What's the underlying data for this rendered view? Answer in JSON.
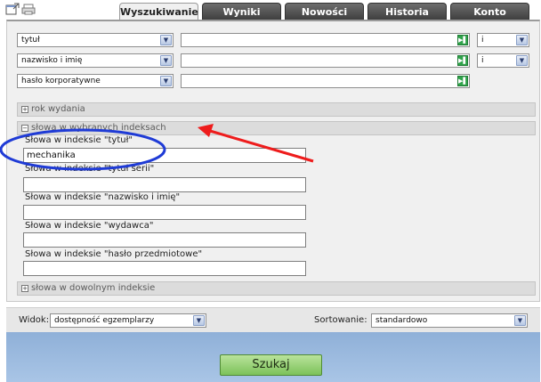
{
  "tabs": [
    {
      "label": "Wyszukiwanie",
      "active": true
    },
    {
      "label": "Wyniki",
      "active": false
    },
    {
      "label": "Nowości",
      "active": false
    },
    {
      "label": "Historia",
      "active": false
    },
    {
      "label": "Konto",
      "active": false
    }
  ],
  "search_rows": [
    {
      "field": "tytuł",
      "value": "",
      "operator": "i"
    },
    {
      "field": "nazwisko i imię",
      "value": "",
      "operator": "i"
    },
    {
      "field": "hasło korporatywne",
      "value": ""
    }
  ],
  "sections": {
    "year": "rok wydania",
    "selected_indexes": "słowa w wybranych indeksach",
    "any_index": "słowa w dowolnym indeksie"
  },
  "index_fields": [
    {
      "label": "Słowa w indeksie \"tytuł\"",
      "value": "mechanika"
    },
    {
      "label": "Słowa w indeksie \"tytuł serii\"",
      "value": ""
    },
    {
      "label": "Słowa w indeksie \"nazwisko i imię\"",
      "value": ""
    },
    {
      "label": "Słowa w indeksie \"wydawca\"",
      "value": ""
    },
    {
      "label": "Słowa w indeksie \"hasło przedmiotowe\"",
      "value": ""
    }
  ],
  "view": {
    "label": "Widok:",
    "selected": "dostępność egzemplarzy"
  },
  "sort": {
    "label": "Sortowanie:",
    "selected": "standardowo"
  },
  "search_button": "Szukaj",
  "colors": {
    "annotation_ellipse": "#1f3bd6",
    "annotation_arrow": "#ee1c1c",
    "submit_green": "#8fd06a",
    "footer_blue": "#9dbde2"
  },
  "icons": {
    "top_left_1": "new-window-icon",
    "top_left_2": "printer-icon",
    "dropdown": "chevron-down-icon",
    "input_action": "green-clear-icon",
    "section_toggle": "plus-box-icon"
  }
}
